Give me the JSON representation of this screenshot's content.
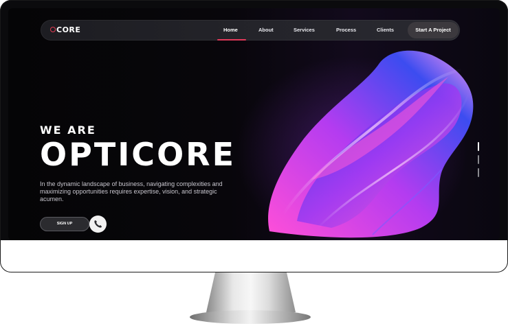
{
  "nav": {
    "logo": "CORE",
    "items": [
      {
        "label": "Home"
      },
      {
        "label": "About"
      },
      {
        "label": "Services"
      },
      {
        "label": "Process"
      },
      {
        "label": "Clients"
      }
    ],
    "cta_label": "Start A Project"
  },
  "hero": {
    "kicker": "WE ARE",
    "brand": "OPTICORE",
    "tagline": "In the dynamic landscape of business, navigating complexities and maximizing opportunities requires expertise, vision, and strategic acumen.",
    "signup_label": "SIGN UP"
  },
  "colors": {
    "accent": "#e2395a",
    "wave_pink": "#e84bd8",
    "wave_blue": "#3c4cf0"
  },
  "icons": {
    "call": "phone-icon",
    "logo_mark": "circle-logo-icon"
  }
}
